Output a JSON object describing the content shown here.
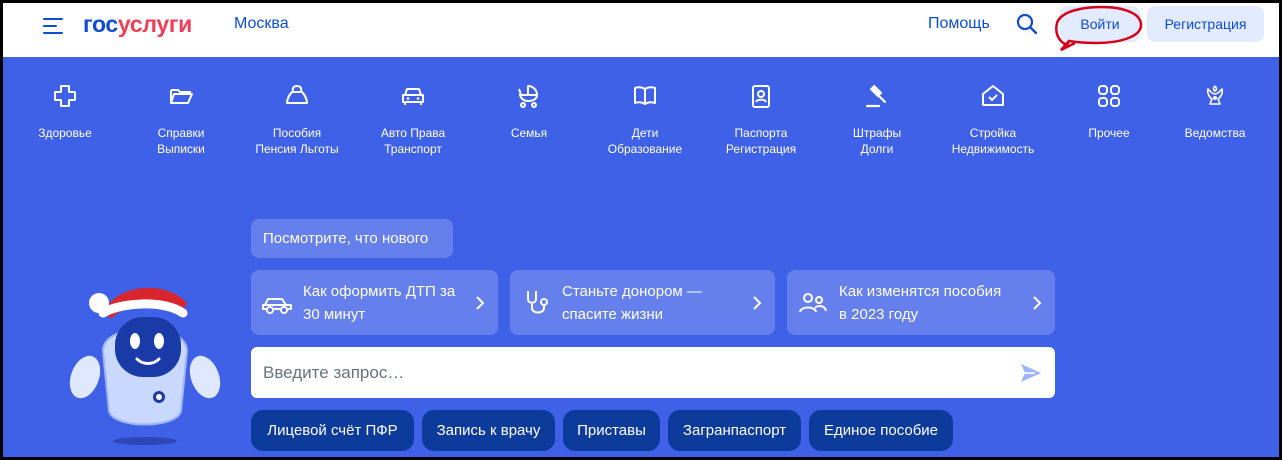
{
  "header": {
    "logo_part1": "гос",
    "logo_part2": "услуги",
    "city": "Москва",
    "help": "Помощь",
    "login": "Войти",
    "register": "Регистрация"
  },
  "categories": [
    {
      "line1": "Здоровье",
      "line2": "",
      "icon": "plus-icon"
    },
    {
      "line1": "Справки",
      "line2": "Выписки",
      "icon": "folder-icon"
    },
    {
      "line1": "Пособия",
      "line2": "Пенсия Льготы",
      "icon": "moneybag-icon"
    },
    {
      "line1": "Авто Права",
      "line2": "Транспорт",
      "icon": "car-icon"
    },
    {
      "line1": "Семья",
      "line2": "",
      "icon": "stroller-icon"
    },
    {
      "line1": "Дети",
      "line2": "Образование",
      "icon": "book-icon"
    },
    {
      "line1": "Паспорта",
      "line2": "Регистрация",
      "icon": "passport-icon"
    },
    {
      "line1": "Штрафы",
      "line2": "Долги",
      "icon": "gavel-icon"
    },
    {
      "line1": "Стройка",
      "line2": "Недвижимость",
      "icon": "house-icon"
    },
    {
      "line1": "Прочее",
      "line2": "",
      "icon": "grid-icon"
    },
    {
      "line1": "Ведомства",
      "line2": "",
      "icon": "emblem-icon"
    }
  ],
  "news_button": "Посмотрите, что нового",
  "cards": [
    {
      "line1": "Как оформить ДТП за",
      "line2": "30 минут",
      "icon": "car-icon"
    },
    {
      "line1": "Станьте донором —",
      "line2": "спасите жизни",
      "icon": "stethoscope-icon"
    },
    {
      "line1": "Как изменятся пособия",
      "line2": "в 2023 году",
      "icon": "people-icon"
    }
  ],
  "search": {
    "placeholder": "Введите запрос…"
  },
  "chips": [
    "Лицевой счёт ПФР",
    "Запись к врачу",
    "Приставы",
    "Загранпаспорт",
    "Единое пособие"
  ],
  "colors": {
    "brand_blue": "#0d4cd3",
    "brand_red": "#ee3f58",
    "background": "#3f61e8",
    "chip": "#0d3b9c",
    "annotation_ring": "#d4001a"
  }
}
